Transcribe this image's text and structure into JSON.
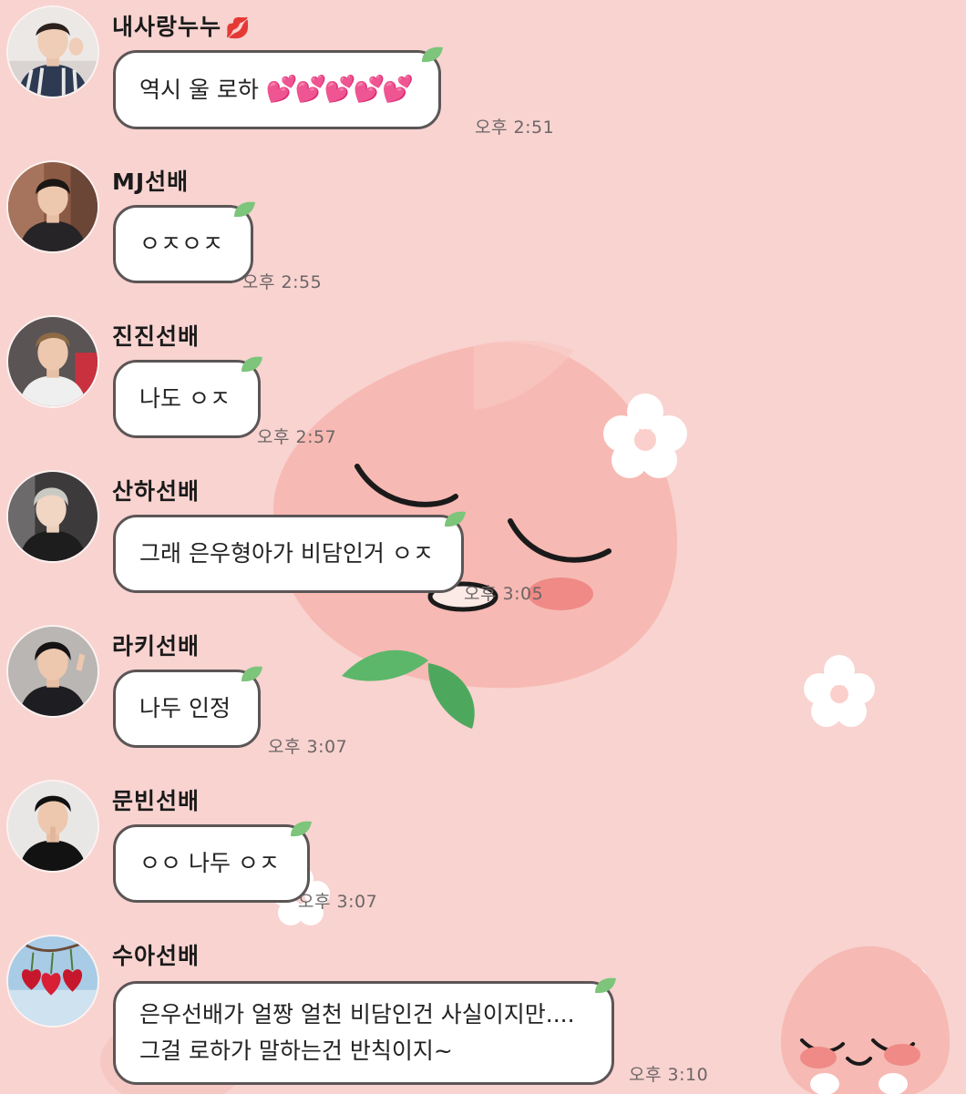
{
  "colors": {
    "background": "#f8d3d0",
    "bubble": "#ffffff",
    "bubble_border": "#5b5556",
    "leaf": "#7cc57a",
    "peach": "#f7b9b3",
    "heart": "#f02c93"
  },
  "messages": [
    {
      "sender": "내사랑누누",
      "sender_emoji": "💋",
      "text": "역시 울 로하",
      "hearts": "💕💕💕💕💕",
      "time": "오후 2:51",
      "avatar_icon": "profile-photo"
    },
    {
      "sender": "MJ선배",
      "text": "ㅇㅈㅇㅈ",
      "time": "오후 2:55",
      "avatar_icon": "profile-photo"
    },
    {
      "sender": "진진선배",
      "text": "나도 ㅇㅈ",
      "time": "오후 2:57",
      "avatar_icon": "profile-photo"
    },
    {
      "sender": "산하선배",
      "text": "그래 은우형아가 비담인거 ㅇㅈ",
      "time": "오후 3:05",
      "avatar_icon": "profile-photo"
    },
    {
      "sender": "라키선배",
      "text": "나두 인정",
      "time": "오후 3:07",
      "avatar_icon": "profile-photo"
    },
    {
      "sender": "문빈선배",
      "text": "ㅇㅇ 나두 ㅇㅈ",
      "time": "오후 3:07",
      "avatar_icon": "profile-photo"
    },
    {
      "sender": "수아선배",
      "text_lines": [
        "은우선배가 얼짱 얼천 비담인건 사실이지만....",
        "그걸 로하가 말하는건 반칙이지~"
      ],
      "time": "오후 3:10",
      "avatar_icon": "heart-cherries-photo"
    }
  ]
}
